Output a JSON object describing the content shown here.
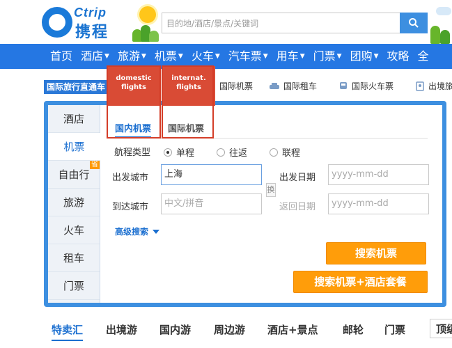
{
  "logo": {
    "en": "Ctrip",
    "cn": "携程"
  },
  "search": {
    "placeholder": "目的地/酒店/景点/关键词"
  },
  "nav": {
    "items": [
      {
        "label": "首页",
        "dropdown": false
      },
      {
        "label": "酒店",
        "dropdown": true
      },
      {
        "label": "旅游",
        "dropdown": true
      },
      {
        "label": "机票",
        "dropdown": true
      },
      {
        "label": "火车",
        "dropdown": true
      },
      {
        "label": "汽车票",
        "dropdown": true
      },
      {
        "label": "用车",
        "dropdown": true
      },
      {
        "label": "门票",
        "dropdown": true
      },
      {
        "label": "团购",
        "dropdown": true
      },
      {
        "label": "攻略",
        "dropdown": false
      },
      {
        "label": "全",
        "dropdown": false
      }
    ]
  },
  "tooltips": {
    "domestic": {
      "line1": "domestic",
      "line2": "flights"
    },
    "internat": {
      "line1": "internat.",
      "line2": "flights"
    }
  },
  "subbar": {
    "intl_label": "国际旅行直通车",
    "links": [
      {
        "label": "国际机票",
        "icon": "plane-icon"
      },
      {
        "label": "国际租车",
        "icon": "car-icon"
      },
      {
        "label": "国际火车票",
        "icon": "train-icon"
      },
      {
        "label": "出境旅",
        "icon": "visa-icon"
      }
    ]
  },
  "sidetabs": [
    {
      "label": "酒店",
      "active": false,
      "badge": ""
    },
    {
      "label": "机票",
      "active": true,
      "badge": ""
    },
    {
      "label": "自由行",
      "active": false,
      "badge": "省"
    },
    {
      "label": "旅游",
      "active": false,
      "badge": ""
    },
    {
      "label": "火车",
      "active": false,
      "badge": ""
    },
    {
      "label": "租车",
      "active": false,
      "badge": ""
    },
    {
      "label": "门票",
      "active": false,
      "badge": ""
    }
  ],
  "flight_tabs": {
    "domestic": "国内机票",
    "international": "国际机票"
  },
  "form": {
    "trip_type_label": "航程类型",
    "trip_types": [
      {
        "label": "单程",
        "selected": true
      },
      {
        "label": "往返",
        "selected": false
      },
      {
        "label": "联程",
        "selected": false
      }
    ],
    "depart_city_label": "出发城市",
    "depart_city_value": "上海",
    "arrive_city_label": "到达城市",
    "arrive_city_placeholder": "中文/拼音",
    "depart_date_label": "出发日期",
    "depart_date_placeholder": "yyyy-mm-dd",
    "return_date_label": "返回日期",
    "return_date_placeholder": "yyyy-mm-dd",
    "swap_label": "换",
    "advanced_label": "高级搜索",
    "search_button": "搜索机票",
    "package_button": "搜索机票+酒店套餐"
  },
  "bottom_tabs": [
    {
      "label": "特卖汇",
      "active": true
    },
    {
      "label": "出境游",
      "active": false
    },
    {
      "label": "国内游",
      "active": false
    },
    {
      "label": "周边游",
      "active": false
    },
    {
      "label": "酒店+景点",
      "active": false
    },
    {
      "label": "邮轮",
      "active": false
    },
    {
      "label": "门票",
      "active": false
    }
  ],
  "bottom_more": "顶级",
  "colors": {
    "primary": "#2577e3",
    "accent": "#ff9d0a",
    "tooltip": "#d94b35"
  }
}
